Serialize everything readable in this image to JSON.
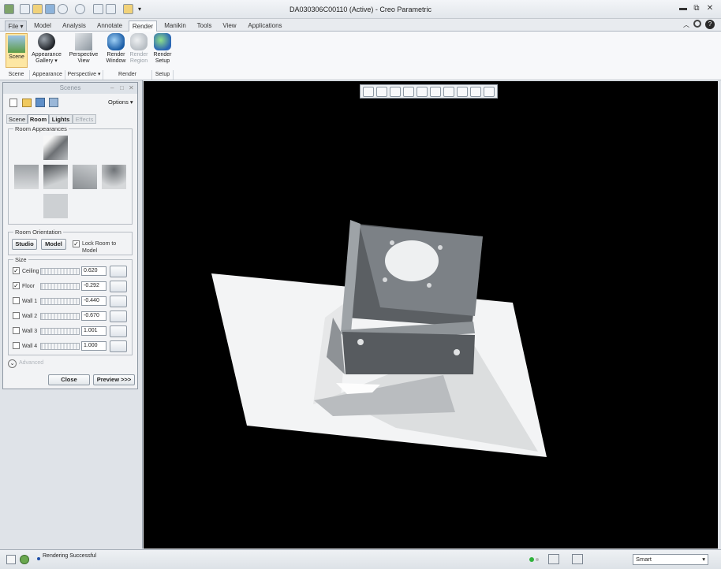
{
  "window": {
    "title": "DA030306C00110 (Active) - Creo Parametric",
    "min": "▬",
    "restore": "⧉",
    "close": "✕"
  },
  "tabs": [
    "File ▾",
    "Model",
    "Analysis",
    "Annotate",
    "Render",
    "Manikin",
    "Tools",
    "View",
    "Applications"
  ],
  "ribbon": {
    "buttons": {
      "scene": "Scene",
      "appearance_gallery": "Appearance Gallery ▾",
      "perspective_view": "Perspective View",
      "render_window": "Render Window",
      "render_region": "Render Region",
      "render_setup": "Render Setup"
    },
    "groups": {
      "scene": "Scene",
      "appearance": "Appearance",
      "perspective": "Perspective ▾",
      "render": "Render",
      "setup": "Setup"
    }
  },
  "dialog": {
    "title": "Scenes",
    "options": "Options ▾",
    "tabs": [
      "Scene",
      "Room",
      "Lights",
      "Effects"
    ],
    "room_appearances_label": "Room Appearances",
    "room_orientation_label": "Room Orientation",
    "studio_button": "Studio",
    "model_button": "Model",
    "lock_room_label": "Lock Room to Model",
    "size_label": "Size",
    "sizes": [
      {
        "label": "Ceiling",
        "checked": true,
        "value": "0.620"
      },
      {
        "label": "Floor",
        "checked": true,
        "value": "-0.292"
      },
      {
        "label": "Wall 1",
        "checked": false,
        "value": "-0.440"
      },
      {
        "label": "Wall 2",
        "checked": false,
        "value": "-0.670"
      },
      {
        "label": "Wall 3",
        "checked": false,
        "value": "1.001"
      },
      {
        "label": "Wall 4",
        "checked": false,
        "value": "1.000"
      }
    ],
    "advanced_label": "Advanced",
    "close_button": "Close",
    "preview_button": "Preview >>>"
  },
  "status": {
    "message": "Rendering Successful",
    "filter": "Smart"
  }
}
